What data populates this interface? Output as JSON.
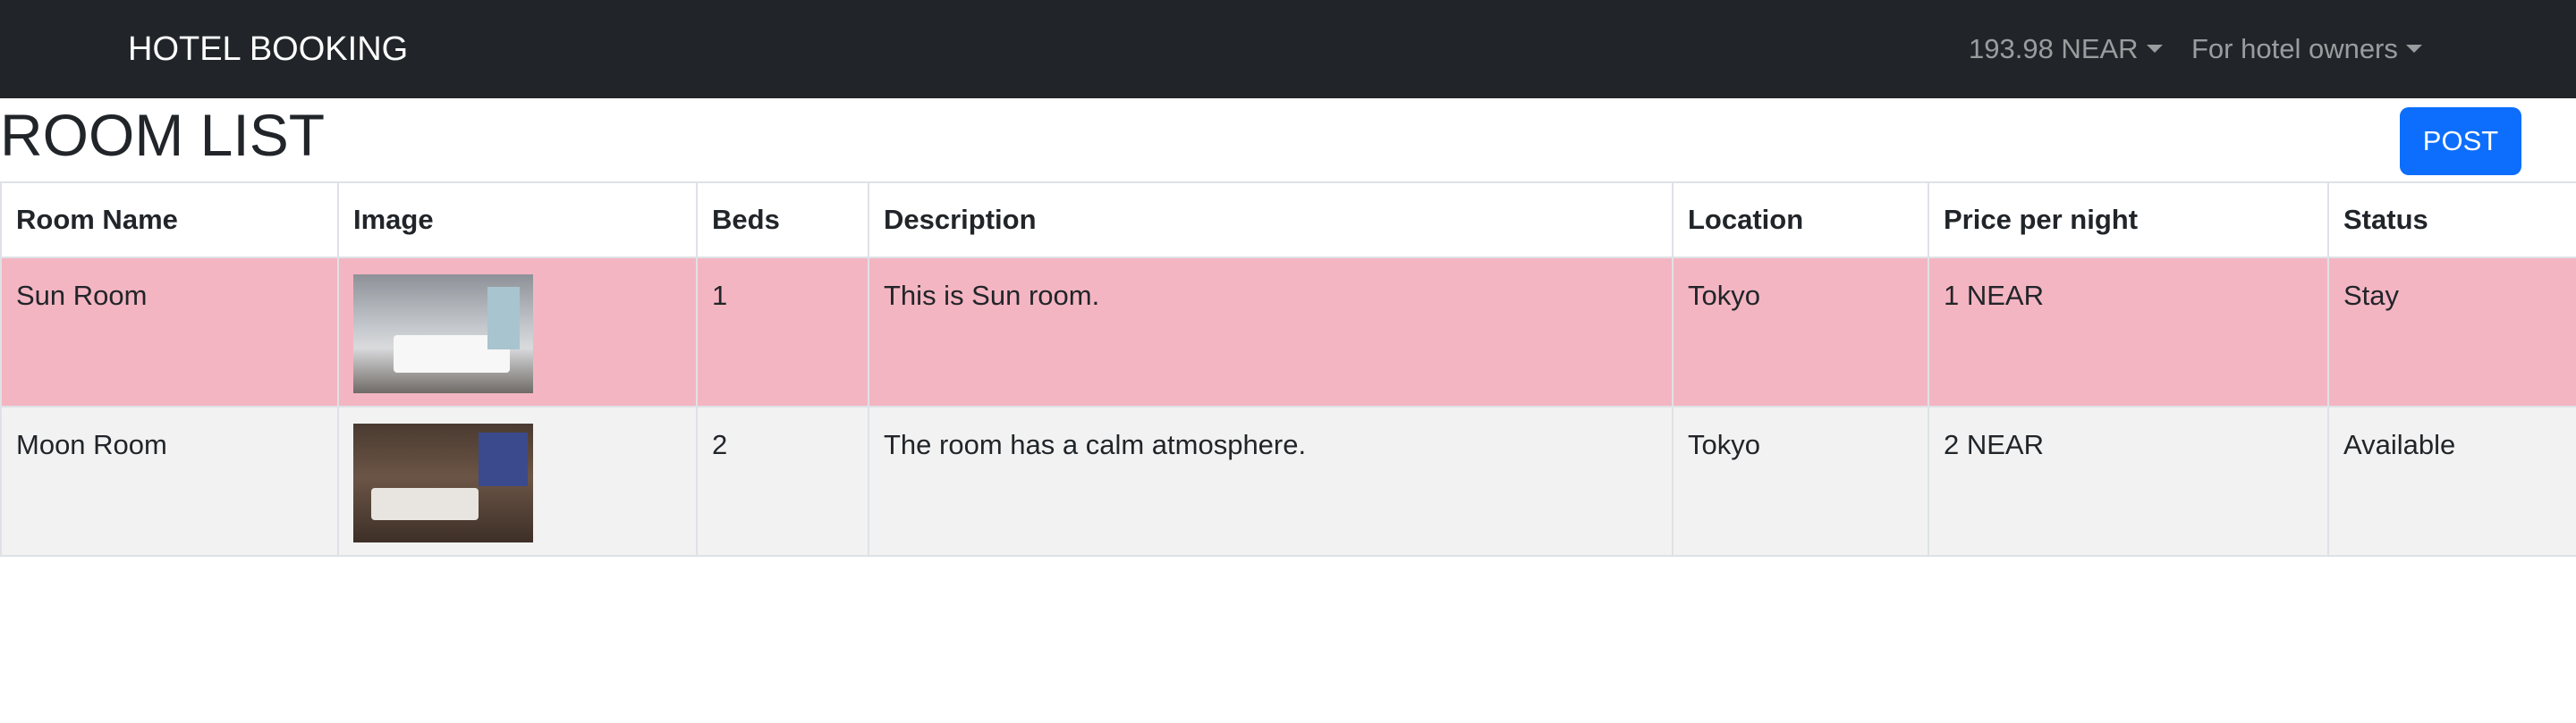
{
  "navbar": {
    "brand": "HOTEL BOOKING",
    "balance": "193.98 NEAR",
    "owners_menu": "For hotel owners"
  },
  "page": {
    "title": "ROOM LIST",
    "post_button": "POST"
  },
  "table": {
    "headers": [
      "Room Name",
      "Image",
      "Beds",
      "Description",
      "Location",
      "Price per night",
      "Status"
    ],
    "rows": [
      {
        "name": "Sun Room",
        "image": "hotel-room-photo",
        "beds": "1",
        "description": "This is Sun room.",
        "location": "Tokyo",
        "price": "1 NEAR",
        "status": "Stay",
        "row_color": "#f4b5c2"
      },
      {
        "name": "Moon Room",
        "image": "hotel-room-photo",
        "beds": "2",
        "description": "The room has a calm atmosphere.",
        "location": "Tokyo",
        "price": "2 NEAR",
        "status": "Available",
        "row_color": "#f2f2f2"
      }
    ]
  },
  "colors": {
    "navbar": "#212529",
    "primary": "#0d6efd",
    "stay_row": "#f4b5c2"
  }
}
